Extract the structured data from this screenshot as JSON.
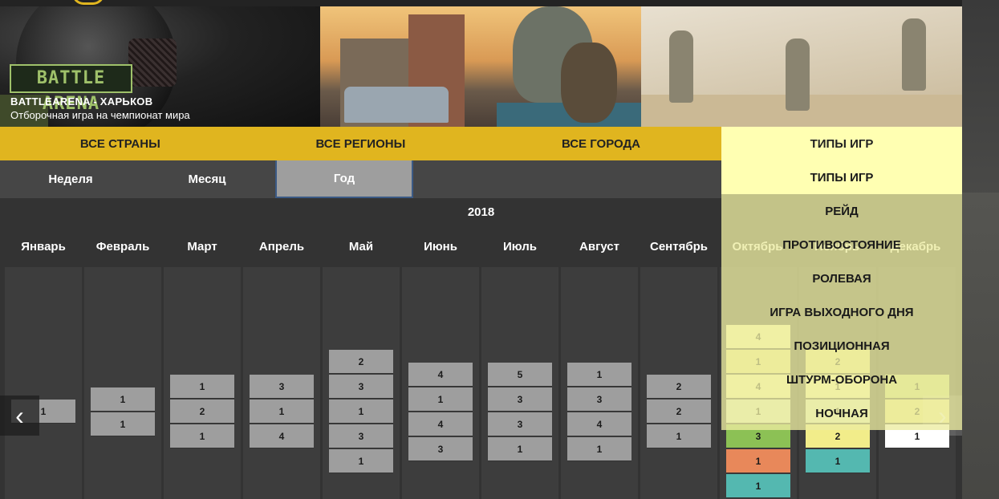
{
  "banner": {
    "brand": "BATTLE ARENA",
    "title": "BATTLEARENA - ХАРЬКОВ",
    "subtitle": "Отборочная игра на чемпионат мира"
  },
  "filters": [
    "ВСЕ СТРАНЫ",
    "ВСЕ РЕГИОНЫ",
    "ВСЕ ГОРОДА"
  ],
  "game_types": {
    "header": "ТИПЫ ИГР",
    "options": [
      "ТИПЫ ИГР",
      "РЕЙД",
      "ПРОТИВОСТОЯНИЕ",
      "РОЛЕВАЯ",
      "ИГРА ВЫХОДНОГО ДНЯ",
      "ПОЗИЦИОННАЯ",
      "ШТУРМ-ОБОРОНА",
      "НОЧНАЯ"
    ],
    "selected": "ТИПЫ ИГР"
  },
  "periods": [
    "Неделя",
    "Месяц",
    "Год"
  ],
  "active_period": "Год",
  "year": "2018",
  "months": [
    "Январь",
    "Февраль",
    "Март",
    "Апрель",
    "Май",
    "Июнь",
    "Июль",
    "Август",
    "Сентябрь",
    "Октябрь",
    "Ноябрь",
    "Декабрь"
  ],
  "calendar": [
    {
      "month": "Январь",
      "counts": [
        "1"
      ]
    },
    {
      "month": "Февраль",
      "counts": [
        "1",
        "1"
      ]
    },
    {
      "month": "Март",
      "counts": [
        "1",
        "2",
        "1"
      ]
    },
    {
      "month": "Апрель",
      "counts": [
        "3",
        "1",
        "4"
      ]
    },
    {
      "month": "Май",
      "counts": [
        "2",
        "3",
        "1",
        "3",
        "1"
      ]
    },
    {
      "month": "Июнь",
      "counts": [
        "4",
        "1",
        "4",
        "3"
      ]
    },
    {
      "month": "Июль",
      "counts": [
        "5",
        "3",
        "3",
        "1"
      ]
    },
    {
      "month": "Август",
      "counts": [
        "1",
        "3",
        "4",
        "1"
      ]
    },
    {
      "month": "Сентябрь",
      "counts": [
        "2",
        "2",
        "1"
      ]
    },
    {
      "month": "Октябрь",
      "counts": [
        "4",
        "1",
        "4",
        "1",
        "3",
        "1",
        "1"
      ],
      "colors": [
        "#ffffb2",
        "#f2ed8a",
        "#ffffb2",
        "#e4f2c8",
        "#8cc155",
        "#e8885a",
        "#54b8b0"
      ]
    },
    {
      "month": "Ноябрь",
      "counts": [
        "2",
        "1",
        "1",
        "2",
        "1"
      ],
      "colors": [
        "#f2ed8a",
        "#ffffb2",
        "#e4f2c8",
        "#f2ed8a",
        "#54b8b0"
      ]
    },
    {
      "month": "Декабрь",
      "counts": [
        "1",
        "2",
        "1"
      ],
      "colors": [
        "#ccde80",
        "#f2ed8a",
        "#ffffff"
      ]
    }
  ],
  "colors": {
    "accent": "#e0b51f",
    "dropdown": "#ffffb2",
    "cell_default": "#9e9e9e"
  },
  "nav": {
    "prev_icon": "chevron-left-icon",
    "next_icon": "chevron-right-icon",
    "prev_glyph": "‹",
    "next_glyph": "›"
  }
}
